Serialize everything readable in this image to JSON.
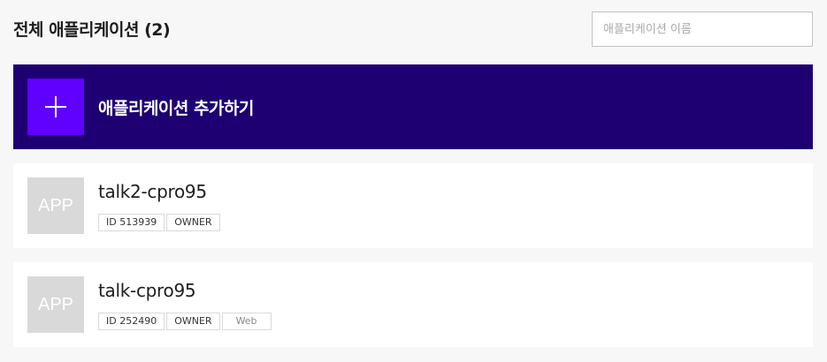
{
  "header": {
    "title": "전체 애플리케이션 (2)",
    "search_placeholder": "애플리케이션 이름"
  },
  "add_app": {
    "icon": "plus-icon",
    "label": "애플리케이션 추가하기"
  },
  "apps": [
    {
      "thumb": "APP",
      "name": "talk2-cpro95",
      "id_tag": "ID 513939",
      "role_tag": "OWNER"
    },
    {
      "thumb": "APP",
      "name": "talk-cpro95",
      "id_tag": "ID 252490",
      "role_tag": "OWNER",
      "platform_tag": "Web"
    }
  ],
  "colors": {
    "background": "#f7f7f7",
    "add_banner": "#1e0072",
    "add_icon_box": "#6000ff",
    "thumb_placeholder": "#d9d9d9"
  }
}
